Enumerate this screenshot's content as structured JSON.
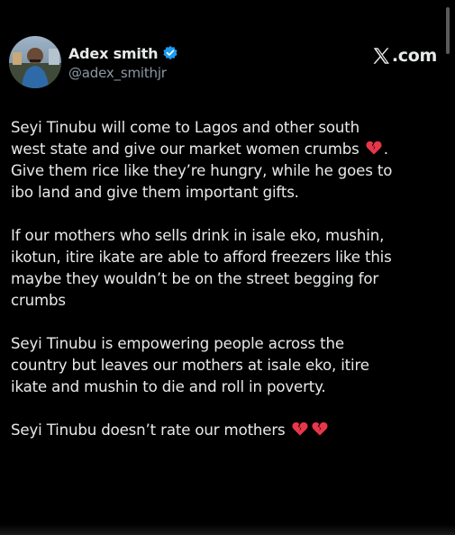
{
  "tweet": {
    "author": {
      "display_name": "Adex smith",
      "handle": "@adex_smithjr",
      "verified_icon": "verified-badge-icon",
      "avatar_icon": "avatar-photo"
    },
    "brand": {
      "logo_icon": "x-logo-icon",
      "text": ".com"
    },
    "paragraphs": [
      {
        "lines": [
          "Seyi Tinubu will come to Lagos and other south",
          "west state and give our market women crumbs",
          "Give them rice like they’re hungry, while he goes to",
          "ibo land and give them important gifts."
        ],
        "line2_suffix": "."
      },
      {
        "lines": [
          "If our mothers who sells drink in isale eko, mushin,",
          "ikotun, itire ikate are able to afford freezers like this",
          "maybe they wouldn’t be on the street begging for",
          "crumbs"
        ]
      },
      {
        "lines": [
          "Seyi Tinubu is empowering people across the",
          "country but leaves our mothers at isale eko, itire",
          "ikate and mushin to die and roll in poverty."
        ]
      },
      {
        "lines": [
          "Seyi Tinubu doesn’t rate our mothers"
        ]
      }
    ],
    "emoji_icon": "broken-heart-icon",
    "colors": {
      "background": "#000000",
      "text": "#e7e9ea",
      "secondary_text": "#8b98a5",
      "verified_blue": "#1d9bf0",
      "broken_heart": "#e8364a"
    }
  }
}
